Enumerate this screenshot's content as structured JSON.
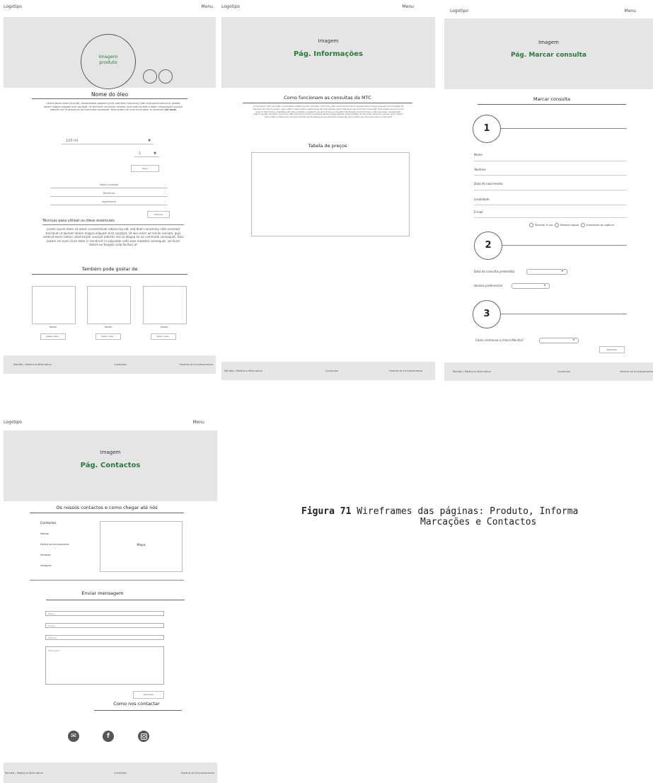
{
  "nav": {
    "logo": "Logotipo",
    "menu": "Menu"
  },
  "footer": {
    "brand": "Meridia | Medicina Alternativa",
    "contacts": "Contactos",
    "hours": "Horário de funcionamento"
  },
  "lorem_short": "Lorem ipsum dolor sit amet, consectetuer adipiscing elit, sed diam nonummy nibh euismod tincidunt ut laoreet dolore magna aliquam erat volutpat. Ut wisi enim ad minim veniam, quis nostrud exerci tation ullamcorper suscipit lobortis nisl ut aliquip ex ea commodo consequat. Duis autem vel eum iriure dolor in hendrerit",
  "lorem_long": "Lorem ipsum dolor sit amet, consectetuer adipiscing elit, sed diam nonummy nibh euismod tincidunt ut laoreet dolore magna aliquam erat volutpat. Ut wisi enim ad minim veniam, quis nostrud exerci tation ullamcorper suscipit lobortis nisl ut aliquip ex ea commodo consequat. Duis autem vel eum iriure dolor in hendrerit in vulputate velit esse molestie consequat, vel illum dolore eu feugiat nulla facilisis at",
  "produto": {
    "hero_img": "Imagem",
    "hero_sub": "produto",
    "title": "Nome do óleo",
    "ler_mais": "Ler mais",
    "size_value": "120 ml",
    "qty_value": "1",
    "price": "Preço",
    "accordion": [
      "Sobre o produto",
      "Benefícios",
      "Ingredientes"
    ],
    "buy_button": "Comprar",
    "techniques_title": "Técnicas para utilizar os óleos essenciais",
    "also_like": "Também pode gostar de",
    "products": [
      {
        "name": "Nome",
        "button": "Saber mais..."
      },
      {
        "name": "Nome",
        "button": "Saber mais..."
      },
      {
        "name": "Nome",
        "button": "Saber mais..."
      }
    ]
  },
  "info": {
    "hero_img": "Imagem",
    "hero_title": "Pág. Informações",
    "title": "Como funcionam as consultas da MTC",
    "prices_title": "Tabela de preços"
  },
  "consulta": {
    "hero_img": "Imagem",
    "hero_title": "Pág. Marcar consulta",
    "title": "Marcar consulta",
    "steps": [
      "1",
      "2",
      "3"
    ],
    "fields": [
      "Nome",
      "Telefone",
      "Data de nascimento",
      "Localidade",
      "E-mail"
    ],
    "radios": [
      "Paciente 1ª vez",
      "Paciente regular",
      "Tratamento de urgência"
    ],
    "date_label": "Data da consulta pretendida",
    "time_label": "Horário preferencial",
    "how_label": "Como conheceu a clínica Meridia?",
    "submit": "Submeter"
  },
  "contactos": {
    "hero_img": "Imagem",
    "hero_title": "Pág. Contactos",
    "title": "Os nossos contactos e como chegar até nós",
    "contacts_heading": "Contactos",
    "contact_items": [
      "Morada",
      "Horário de funcionamento",
      "Facebook",
      "Instagram"
    ],
    "map": "Mapa",
    "message_title": "Enviar mensagem",
    "inputs": [
      "Nome",
      "E-mail",
      "Telefone",
      "Mensagem"
    ],
    "submit": "Submeter",
    "how_contact": "Como nos contactar",
    "social": [
      "email-icon",
      "facebook-icon",
      "instagram-icon"
    ]
  },
  "caption": {
    "figure": "Figura 71",
    "text_line1": " Wireframes das páginas: Produto, Informa",
    "text_line2": "Marcações e Contactos"
  }
}
